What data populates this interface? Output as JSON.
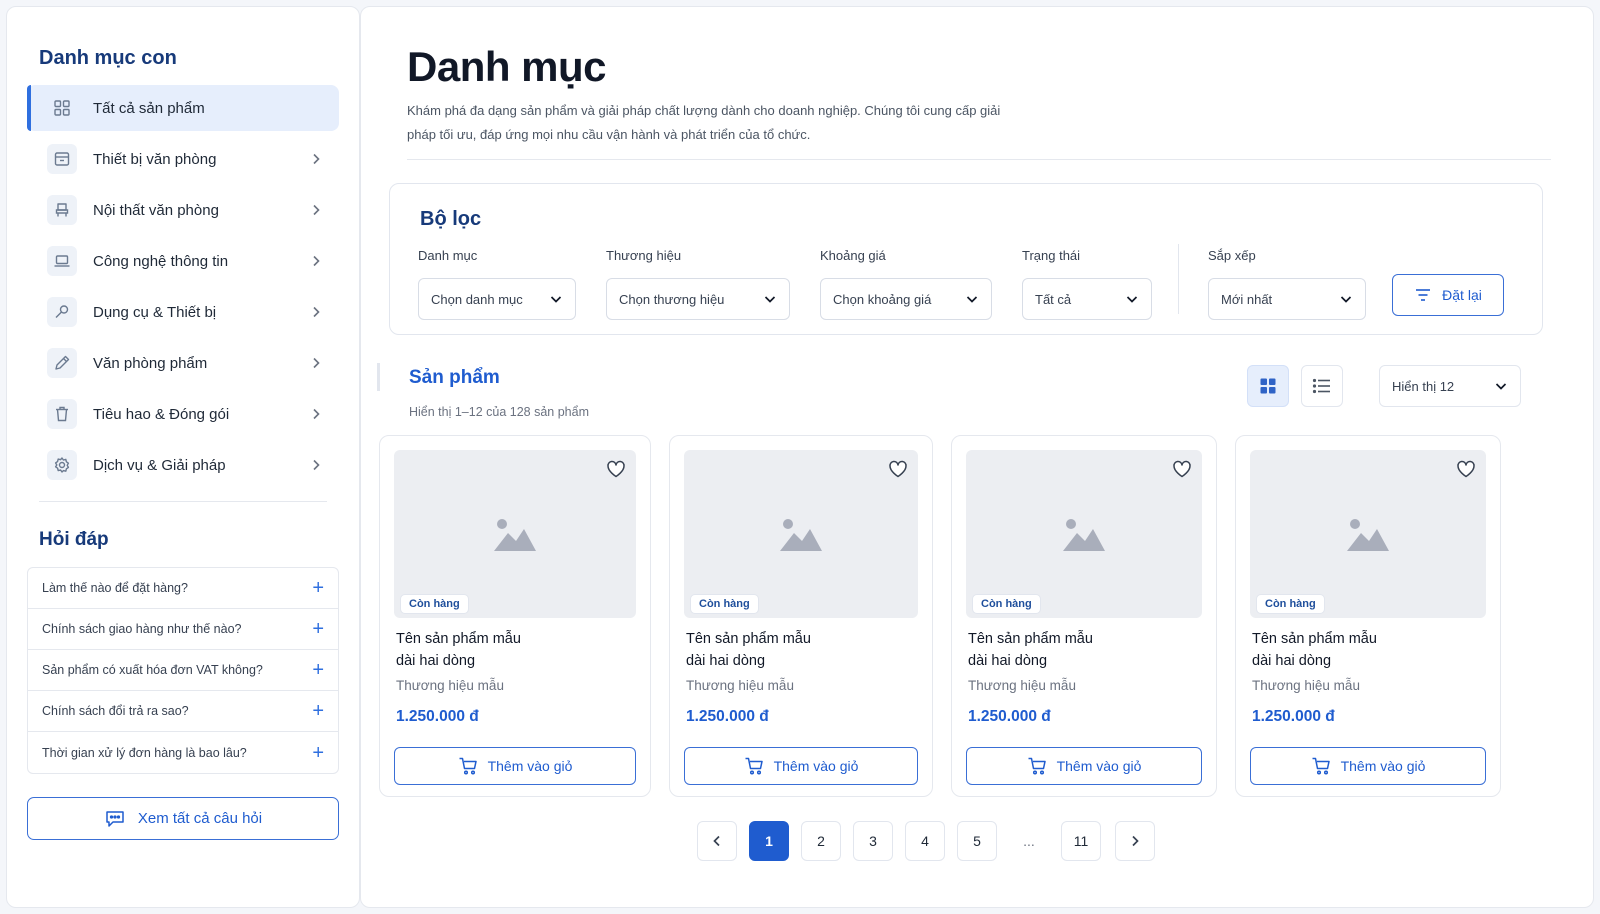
{
  "sidebar": {
    "title": "Danh mục con",
    "categories": [
      {
        "label": "Tất cả sản phẩm",
        "icon": "grid-icon",
        "active": true
      },
      {
        "label": "Thiết bị văn phòng",
        "icon": "printer-icon"
      },
      {
        "label": "Nội thất văn phòng",
        "icon": "chair-icon"
      },
      {
        "label": "Công nghệ thông tin",
        "icon": "laptop-icon"
      },
      {
        "label": "Dụng cụ & Thiết bị",
        "icon": "wrench-icon"
      },
      {
        "label": "Văn phòng phẩm",
        "icon": "pencil-icon"
      },
      {
        "label": "Tiêu hao & Đóng gói",
        "icon": "trash-icon"
      },
      {
        "label": "Dịch vụ & Giải pháp",
        "icon": "gear-icon"
      }
    ],
    "faq_title": "Hỏi đáp",
    "faq": [
      "Làm thế nào để đặt hàng?",
      "Chính sách giao hàng như thế nào?",
      "Sản phẩm có xuất hóa đơn VAT không?",
      "Chính sách đổi trả ra sao?",
      "Thời gian xử lý đơn hàng là bao lâu?"
    ],
    "faq_all_label": "Xem tất cả câu hỏi"
  },
  "header": {
    "title": "Danh mục",
    "description": "Khám phá đa dạng sản phẩm và giải pháp chất lượng dành cho doanh nghiệp. Chúng tôi cung cấp giải pháp tối ưu, đáp ứng mọi nhu cầu vận hành và phát triển của tổ chức."
  },
  "filters": {
    "title": "Bộ lọc",
    "category": {
      "label": "Danh mục",
      "value": "Chọn danh mục"
    },
    "brand": {
      "label": "Thương hiệu",
      "value": "Chọn thương hiệu"
    },
    "price": {
      "label": "Khoảng giá",
      "value": "Chọn khoảng giá"
    },
    "status": {
      "label": "Trạng thái",
      "value": "Tất cả"
    },
    "sort": {
      "label": "Sắp xếp",
      "value": "Mới nhất"
    },
    "reset_label": "Đặt lại"
  },
  "products": {
    "title": "Sản phẩm",
    "count_text": "Hiển thị 1–12 của 128 sản phẩm",
    "page_size": "Hiển thị 12",
    "items": [
      {
        "badge": "Còn hàng",
        "name_line1": "Tên sản phẩm mẫu",
        "name_line2": "dài hai dòng",
        "brand": "Thương hiệu mẫu",
        "price": "1.250.000 đ",
        "cart_label": "Thêm vào giỏ"
      },
      {
        "badge": "Còn hàng",
        "name_line1": "Tên sản phẩm mẫu",
        "name_line2": "dài hai dòng",
        "brand": "Thương hiệu mẫu",
        "price": "1.250.000 đ",
        "cart_label": "Thêm vào giỏ"
      },
      {
        "badge": "Còn hàng",
        "name_line1": "Tên sản phẩm mẫu",
        "name_line2": "dài hai dòng",
        "brand": "Thương hiệu mẫu",
        "price": "1.250.000 đ",
        "cart_label": "Thêm vào giỏ"
      },
      {
        "badge": "Còn hàng",
        "name_line1": "Tên sản phẩm mẫu",
        "name_line2": "dài hai dòng",
        "brand": "Thương hiệu mẫu",
        "price": "1.250.000 đ",
        "cart_label": "Thêm vào giỏ"
      }
    ]
  },
  "pagination": {
    "pages": [
      "1",
      "2",
      "3",
      "4",
      "5",
      "...",
      "11"
    ],
    "current": "1"
  },
  "colors": {
    "accent": "#1f5ccf",
    "heading": "#173a7a",
    "active_bg": "#e6eefc"
  }
}
